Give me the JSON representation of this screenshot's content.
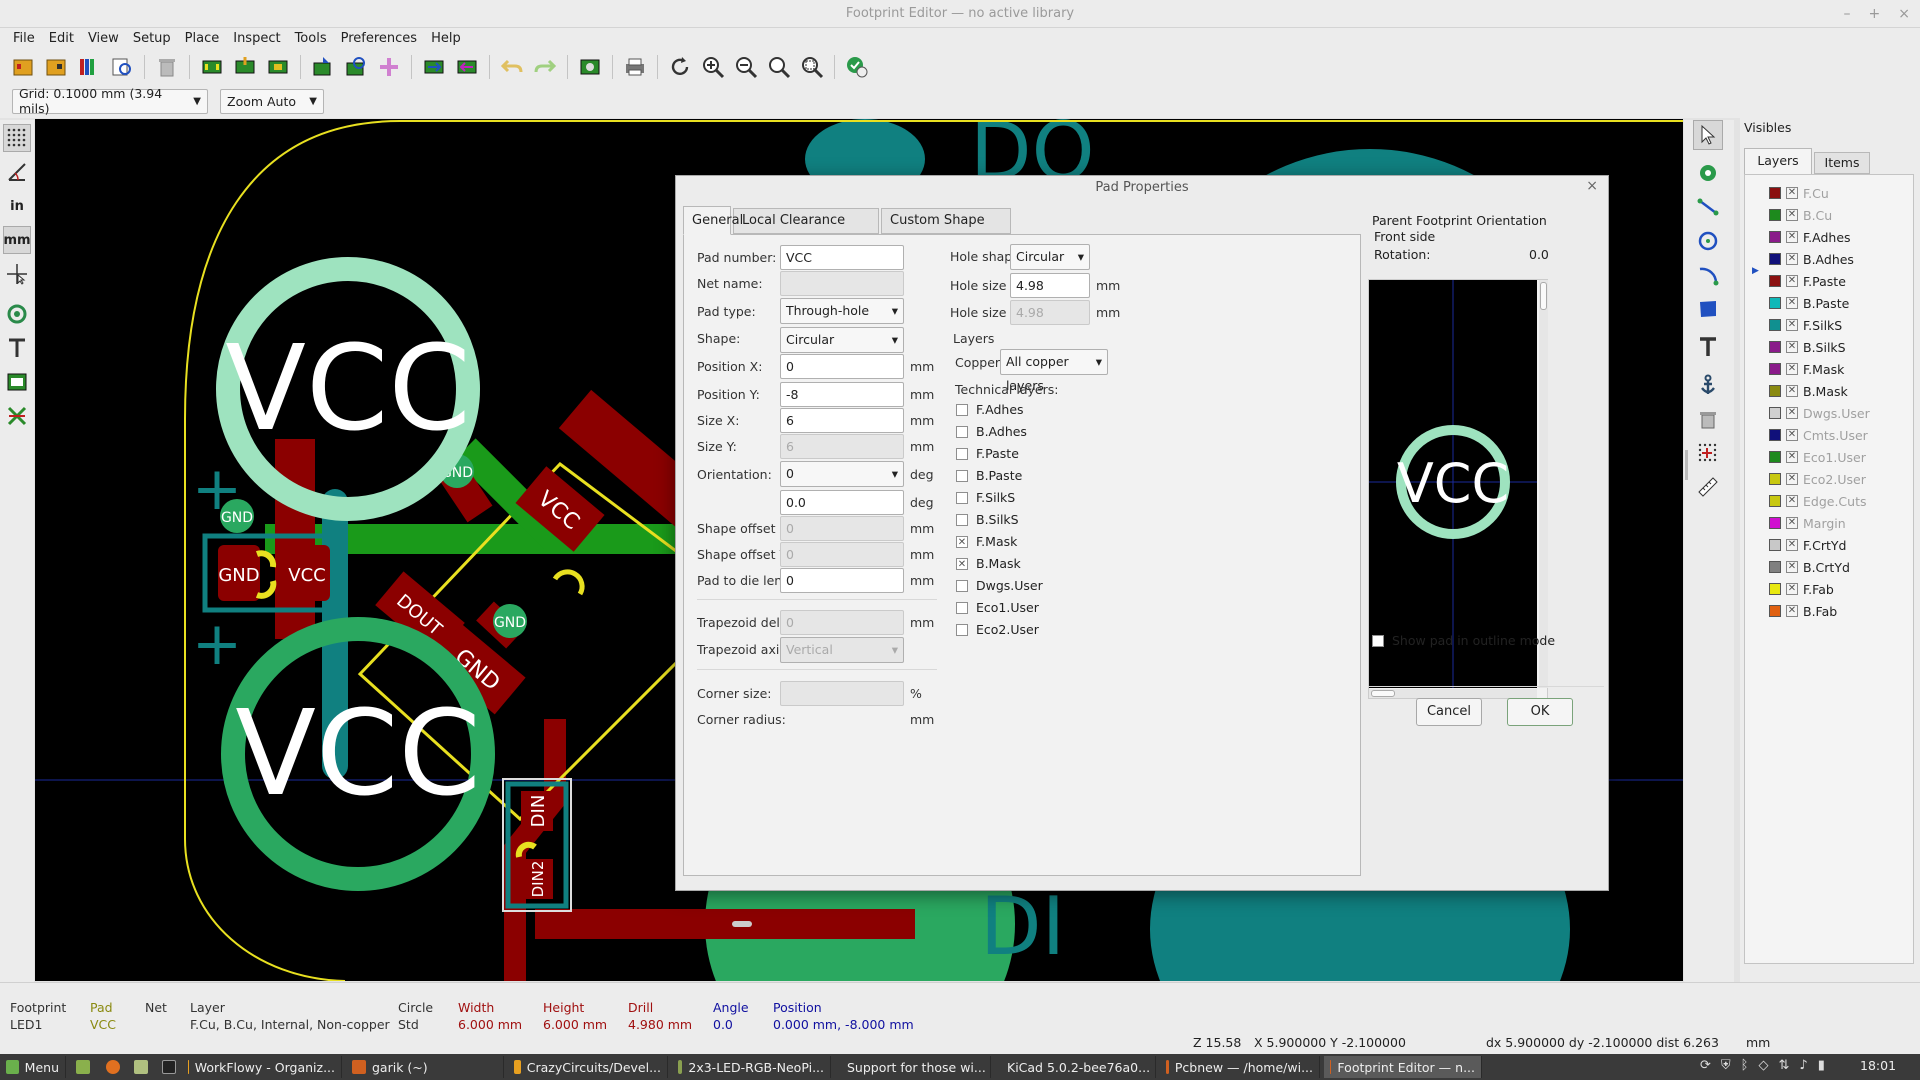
{
  "window": {
    "title": "Footprint Editor — no active library",
    "controls": [
      "–",
      "+",
      "×"
    ]
  },
  "menu": [
    "File",
    "Edit",
    "View",
    "Setup",
    "Place",
    "Inspect",
    "Tools",
    "Preferences",
    "Help"
  ],
  "toolbar2": {
    "grid": "Grid: 0.1000 mm (3.94 mils)",
    "zoom": "Zoom Auto"
  },
  "left_tools": [
    "grid",
    "polar",
    "in",
    "mm",
    "cursor",
    "pad",
    "text",
    "layer",
    "ratsnest"
  ],
  "left_units": {
    "in": "in",
    "mm": "mm"
  },
  "canvas": {
    "pad_large_top": "VCC",
    "pad_large_bottom": "VCC",
    "pad_gnd_a": "GND",
    "pad_vcc_small": "VCC",
    "gnd_small_1": "GND",
    "gnd_small_2": "GND",
    "gnd_small_3": "GND",
    "diag_vcc": "VCC",
    "diag_dout": "DOUT",
    "diag_gnd": "GND",
    "din": "DIN",
    "din2": "DIN2",
    "di_text": "DI",
    "do_text": "DO",
    "plus": "+"
  },
  "layers_panel": {
    "header": "Visibles",
    "tabs": [
      "Layers",
      "Items"
    ],
    "layers": [
      {
        "name": "F.Cu",
        "color": "#8b1010",
        "dim": true
      },
      {
        "name": "B.Cu",
        "color": "#1d8a1d",
        "dim": true
      },
      {
        "name": "F.Adhes",
        "color": "#8a1a8a",
        "dim": false
      },
      {
        "name": "B.Adhes",
        "color": "#10107a",
        "dim": false
      },
      {
        "name": "F.Paste",
        "color": "#8b1010",
        "dim": false
      },
      {
        "name": "B.Paste",
        "color": "#10b8b8",
        "dim": false
      },
      {
        "name": "F.SilkS",
        "color": "#109090",
        "dim": false
      },
      {
        "name": "B.SilkS",
        "color": "#8a1a8a",
        "dim": false
      },
      {
        "name": "F.Mask",
        "color": "#8a1a8a",
        "dim": false
      },
      {
        "name": "B.Mask",
        "color": "#8a8a10",
        "dim": false
      },
      {
        "name": "Dwgs.User",
        "color": "#d0d0d0",
        "dim": true
      },
      {
        "name": "Cmts.User",
        "color": "#10107a",
        "dim": true
      },
      {
        "name": "Eco1.User",
        "color": "#1d8a1d",
        "dim": true
      },
      {
        "name": "Eco2.User",
        "color": "#c8c810",
        "dim": true
      },
      {
        "name": "Edge.Cuts",
        "color": "#c8c810",
        "dim": true
      },
      {
        "name": "Margin",
        "color": "#d010d0",
        "dim": true
      },
      {
        "name": "F.CrtYd",
        "color": "#c8c8c8",
        "dim": false
      },
      {
        "name": "B.CrtYd",
        "color": "#808080",
        "dim": false
      },
      {
        "name": "F.Fab",
        "color": "#e8e810",
        "dim": false
      },
      {
        "name": "B.Fab",
        "color": "#e06010",
        "dim": false
      }
    ]
  },
  "dialog": {
    "title": "Pad Properties",
    "tabs": [
      "General",
      "Local Clearance and Settings",
      "Custom Shape Primitives"
    ],
    "pad_number_label": "Pad number:",
    "pad_number": "VCC",
    "net_name_label": "Net name:",
    "net_name": "",
    "pad_type_label": "Pad type:",
    "pad_type": "Through-hole",
    "shape_label": "Shape:",
    "shape": "Circular",
    "pos_x_label": "Position X:",
    "pos_x": "0",
    "pos_y_label": "Position Y:",
    "pos_y": "-8",
    "size_x_label": "Size X:",
    "size_x": "6",
    "size_y_label": "Size Y:",
    "size_y": "6",
    "orientation_label": "Orientation:",
    "orientation": "0",
    "orientation_value": "0.0",
    "shape_offset_x_label": "Shape offset X:",
    "shape_offset_x": "0",
    "shape_offset_y_label": "Shape offset Y:",
    "shape_offset_y": "0",
    "pad_die_label": "Pad to die length:",
    "pad_die": "0",
    "trap_delta_label": "Trapezoid delta:",
    "trap_delta": "0",
    "trap_axis_label": "Trapezoid axis:",
    "trap_axis": "Vertical",
    "corner_size_label": "Corner size:",
    "corner_size": "",
    "corner_radius_label": "Corner radius:",
    "unit_mm": "mm",
    "unit_deg": "deg",
    "unit_pct": "%",
    "hole_shape_label": "Hole shape:",
    "hole_shape": "Circular",
    "hole_x_label": "Hole size X:",
    "hole_x": "4.98",
    "hole_y_label": "Hole size Y:",
    "hole_y": "4.98",
    "layers_heading": "Layers",
    "copper_label": "Copper:",
    "copper": "All copper layers",
    "tech_heading": "Technical layers:",
    "tech_layers": [
      {
        "name": "F.Adhes",
        "checked": false
      },
      {
        "name": "B.Adhes",
        "checked": false
      },
      {
        "name": "F.Paste",
        "checked": false
      },
      {
        "name": "B.Paste",
        "checked": false
      },
      {
        "name": "F.SilkS",
        "checked": false
      },
      {
        "name": "B.SilkS",
        "checked": false
      },
      {
        "name": "F.Mask",
        "checked": true
      },
      {
        "name": "B.Mask",
        "checked": true
      },
      {
        "name": "Dwgs.User",
        "checked": false
      },
      {
        "name": "Eco1.User",
        "checked": false
      },
      {
        "name": "Eco2.User",
        "checked": false
      }
    ],
    "parent_heading": "Parent Footprint Orientation",
    "front_side": "Front side",
    "rotation_label": "Rotation:",
    "rotation": "0.0",
    "preview_pad": "VCC",
    "outline_label": "Show pad in outline mode",
    "cancel": "Cancel",
    "ok": "OK"
  },
  "status": {
    "cols": [
      {
        "h": "Footprint",
        "v": "LED1",
        "hc": "#333",
        "vc": "#333"
      },
      {
        "h": "Pad",
        "v": "VCC",
        "hc": "#8a8a10",
        "vc": "#8a8a10"
      },
      {
        "h": "Net",
        "v": "",
        "hc": "#333",
        "vc": "#333"
      },
      {
        "h": "Layer",
        "v": "F.Cu, B.Cu, Internal, Non-copper",
        "hc": "#333",
        "vc": "#333"
      },
      {
        "h": "Circle",
        "v": "Std",
        "hc": "#333",
        "vc": "#333"
      },
      {
        "h": "Width",
        "v": "6.000 mm",
        "hc": "#a01010",
        "vc": "#a01010"
      },
      {
        "h": "Height",
        "v": "6.000 mm",
        "hc": "#a01010",
        "vc": "#a01010"
      },
      {
        "h": "Drill",
        "v": "4.980 mm",
        "hc": "#a01010",
        "vc": "#a01010"
      },
      {
        "h": "Angle",
        "v": "0.0",
        "hc": "#1010a0",
        "vc": "#1010a0"
      },
      {
        "h": "Position",
        "v": "0.000 mm, -8.000 mm",
        "hc": "#1010a0",
        "vc": "#1010a0"
      }
    ],
    "zoom": "Z 15.58",
    "xy": "X 5.900000  Y -2.100000",
    "dxy": "dx 5.900000  dy -2.100000  dist 6.263",
    "units": "mm"
  },
  "taskbar": {
    "menu": "Menu",
    "tasks": [
      {
        "label": "WorkFlowy - Organiz...",
        "color": "#e8a020"
      },
      {
        "label": "garik (~)",
        "color": "#d06020"
      },
      {
        "label": "CrazyCircuits/Devel...",
        "color": "#e8a020"
      },
      {
        "label": "2x3-LED-RGB-NeoPi...",
        "color": "#8aa050"
      },
      {
        "label": "Support for those wi...",
        "color": "#e8a020"
      },
      {
        "label": "KiCad 5.0.2-bee76a0...",
        "color": "#c02020"
      },
      {
        "label": "Pcbnew — /home/wi...",
        "color": "#d06020"
      },
      {
        "label": "Footprint Editor — n...",
        "color": "#d06020"
      }
    ],
    "clock": "18:01"
  }
}
